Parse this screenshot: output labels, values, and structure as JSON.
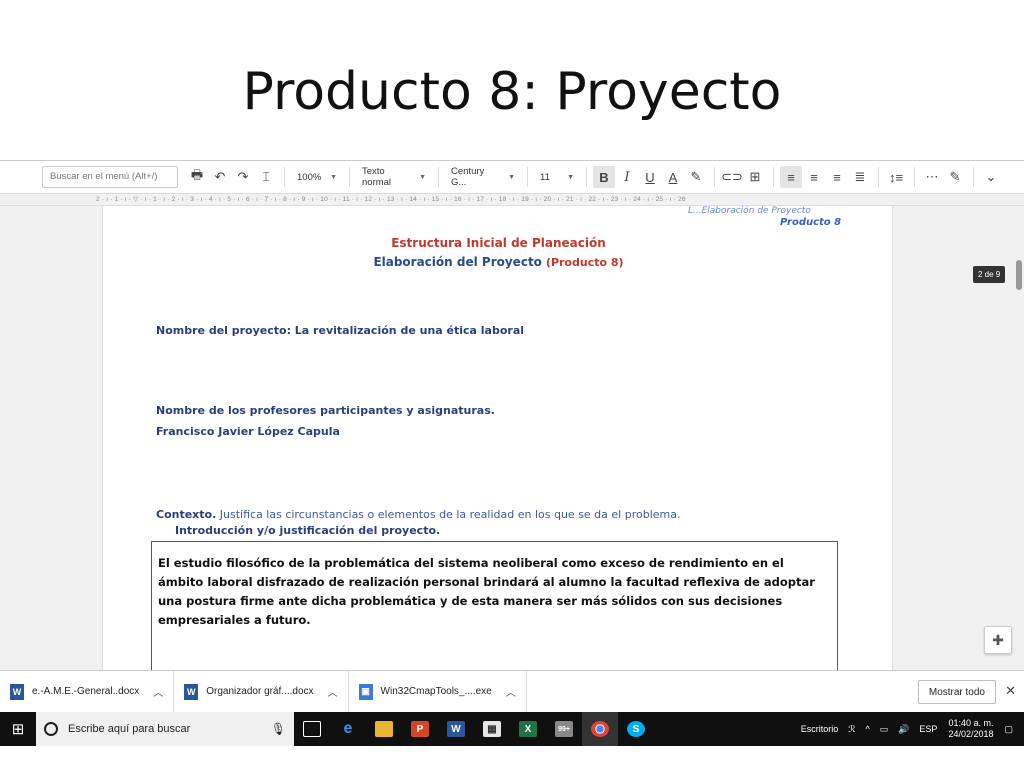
{
  "slide": {
    "title": "Producto 8: Proyecto"
  },
  "toolbar": {
    "search_placeholder": "Buscar en el menú (Alt+/)",
    "zoom": "100%",
    "style": "Texto normal",
    "font": "Century G...",
    "size": "11"
  },
  "ruler": {
    "text": "2 · ı · 1 · ı · ▽ · ı · 1 · ı · 2 · ı · 3 · ı · 4 · ı · 5 · ı · 6 · ı · 7 · ı · 8 · ı · 9 · ı · 10 · ı · 11 · ı · 12 · ı · 13 · ı · 14 · ı · 15 · ı · 16 · ı · 17 · ı · 18 · ı · 19 · ı · 20 · ı · 21 · ı · 22 · ı · 23 · ı · 24 · ı · 25 · ı · 26"
  },
  "document": {
    "header_faded": "L...Elaboración de Proyecto",
    "header_product": "Producto 8",
    "title_line1": "Estructura Inicial de Planeación",
    "title_line2": "Elaboración del Proyecto",
    "title_line2_red": "(Producto 8)",
    "project_name": "Nombre del proyecto:   La revitalización de una ética laboral",
    "teachers_label": "Nombre de los profesores participantes y asignaturas.",
    "teacher_name": "Francisco Javier López Capula",
    "context_label": "Contexto.",
    "context_rest": " Justifica las circunstancias o elementos de la realidad en los que se da el problema.",
    "intro_label": "Introducción y/o justificación del proyecto.",
    "intro_text": "El estudio filosófico de la problemática del sistema neoliberal como exceso de rendimiento en el ámbito laboral disfrazado de realización personal brindará al alumno la facultad reflexiva de adoptar una postura firme ante dicha problemática y de esta manera ser más sólidos con sus decisiones empresariales a futuro."
  },
  "page_indicator": "2 de 9",
  "downloads": {
    "items": [
      {
        "name": "e.-A.M.E.-General..docx",
        "icon": "word-doc-icon",
        "color": "#2b579a"
      },
      {
        "name": "Organizador gráf....docx",
        "icon": "word-doc-icon",
        "color": "#2b579a"
      },
      {
        "name": "Win32CmapTools_....exe",
        "icon": "exe-icon",
        "color": "#3a7bd5"
      }
    ],
    "show_all": "Mostrar todo"
  },
  "taskbar": {
    "search_placeholder": "Escribe aquí para buscar",
    "apps": [
      {
        "name": "task-view-icon",
        "label": "⧉",
        "bg": ""
      },
      {
        "name": "edge-icon",
        "label": "e",
        "bg": "#1e6fd9"
      },
      {
        "name": "file-explorer-icon",
        "label": "▬",
        "bg": "#e8b534"
      },
      {
        "name": "powerpoint-icon",
        "label": "P",
        "bg": "#d24726"
      },
      {
        "name": "word-icon",
        "label": "W",
        "bg": "#2b579a"
      },
      {
        "name": "store-icon",
        "label": "▦",
        "bg": "#555"
      },
      {
        "name": "excel-icon",
        "label": "X",
        "bg": "#217346"
      },
      {
        "name": "mail-icon",
        "label": "99+",
        "bg": "#777"
      },
      {
        "name": "chrome-icon",
        "label": "◉",
        "bg": "#db4437"
      },
      {
        "name": "skype-icon",
        "label": "S",
        "bg": "#00aff0"
      }
    ],
    "desktop": "Escritorio",
    "language": "ESP",
    "time": "01:40 a. m.",
    "date": "24/02/2018"
  }
}
